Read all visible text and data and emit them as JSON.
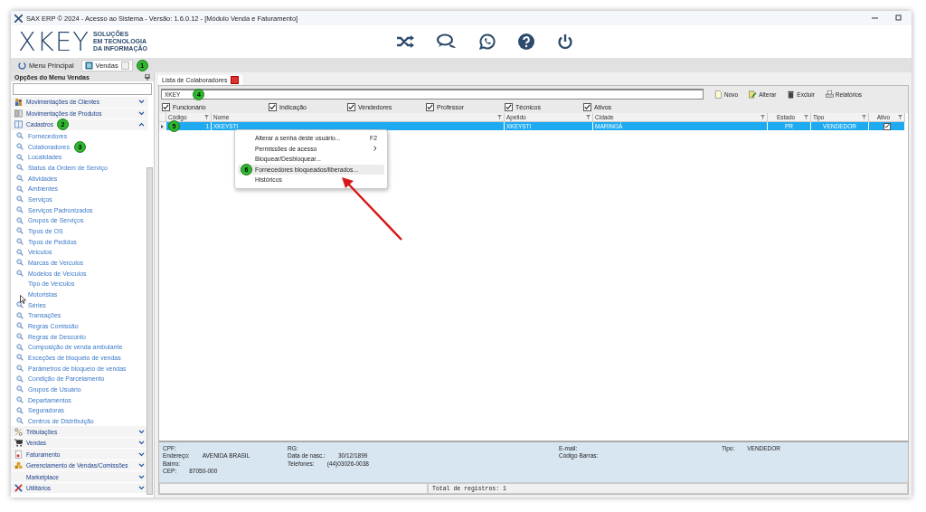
{
  "window": {
    "title": "SAX ERP © 2024 - Acesso ao Sistema - Versão: 1.6.0.12 - [Módulo Venda e Faturamento]"
  },
  "logo": {
    "mark": "XKEY",
    "tagline": [
      "SOLUÇÕES",
      "EM TECNOLOGIA",
      "DA INFORMAÇÃO"
    ]
  },
  "header_icons": [
    {
      "kind": "shuffle"
    },
    {
      "kind": "chat"
    },
    {
      "kind": "whatsapp"
    },
    {
      "kind": "help"
    },
    {
      "kind": "power"
    }
  ],
  "module_tabs": [
    {
      "label": "Menu Principal",
      "kind": "home",
      "selected": false
    },
    {
      "label": "Vendas",
      "kind": "module",
      "selected": true,
      "closable": true,
      "badge": "1"
    }
  ],
  "sidebar": {
    "title": "Opções do Menu Vendas",
    "groups": [
      {
        "label": "Movimentações de Clientes",
        "kind": "people",
        "expanded": false
      },
      {
        "label": "Movimentações de Produtos",
        "kind": "boxes",
        "expanded": false
      },
      {
        "label": "Cadastros",
        "kind": "book",
        "expanded": true,
        "badge": "2",
        "children": [
          {
            "label": "Fornecedores",
            "kind": "search"
          },
          {
            "label": "Colaboradores",
            "kind": "search",
            "badge": "3"
          },
          {
            "label": "Localidades",
            "kind": "search"
          },
          {
            "label": "Status da Ordem de Serviço",
            "kind": "search"
          },
          {
            "label": "Atividades",
            "kind": "search"
          },
          {
            "label": "Ambientes",
            "kind": "search"
          },
          {
            "label": "Serviços",
            "kind": "search"
          },
          {
            "label": "Serviços Padronizados",
            "kind": "search"
          },
          {
            "label": "Grupos de Serviços",
            "kind": "search"
          },
          {
            "label": "Tipos de OS",
            "kind": "search"
          },
          {
            "label": "Tipos de Pedidos",
            "kind": "search"
          },
          {
            "label": "Veículos",
            "kind": "search"
          },
          {
            "label": "Marcas de Veículos",
            "kind": "search"
          },
          {
            "label": "Modelos de Veículos",
            "kind": "search"
          },
          {
            "label": "Tipo de Veículos",
            "kind": "plain"
          },
          {
            "label": "Motoristas",
            "kind": "plain"
          },
          {
            "label": "Séries",
            "kind": "search"
          },
          {
            "label": "Transações",
            "kind": "search"
          },
          {
            "label": "Regras Comissão",
            "kind": "search"
          },
          {
            "label": "Regras de Desconto",
            "kind": "search"
          },
          {
            "label": "Composição de venda ambulante",
            "kind": "search"
          },
          {
            "label": "Exceções de bloqueio de vendas",
            "kind": "search"
          },
          {
            "label": "Parâmetros de bloqueio de vendas",
            "kind": "search"
          },
          {
            "label": "Condição de Parcelamento",
            "kind": "search"
          },
          {
            "label": "Grupos de Usuário",
            "kind": "search"
          },
          {
            "label": "Departamentos",
            "kind": "search"
          },
          {
            "label": "Seguradoras",
            "kind": "search"
          },
          {
            "label": "Centros de Distribuição",
            "kind": "search"
          }
        ]
      },
      {
        "label": "Tributações",
        "kind": "percent",
        "expanded": false
      },
      {
        "label": "Vendas",
        "kind": "cart",
        "expanded": false
      },
      {
        "label": "Faturamento",
        "kind": "invoice",
        "expanded": false
      },
      {
        "label": "Gerenciamento de Vendas/Comissões",
        "kind": "coins",
        "expanded": false
      },
      {
        "label": "Marketplace",
        "kind": "plain",
        "expanded": false
      },
      {
        "label": "Utilitários",
        "kind": "tools",
        "expanded": false
      }
    ]
  },
  "document_tab": {
    "label": "Lista de Colaboradores"
  },
  "search": {
    "value": "XKEY",
    "badge": "4"
  },
  "actions": [
    {
      "label": "Novo",
      "kind": "new"
    },
    {
      "label": "Alterar",
      "kind": "edit"
    },
    {
      "label": "Excluir",
      "kind": "delete"
    },
    {
      "label": "Relatórios",
      "kind": "print"
    }
  ],
  "filters": [
    {
      "label": "Funcionário",
      "checked": true
    },
    {
      "label": "Indicação",
      "checked": true
    },
    {
      "label": "Vendedores",
      "checked": true
    },
    {
      "label": "Professor",
      "checked": true
    },
    {
      "label": "Técnicos",
      "checked": true
    },
    {
      "label": "Ativos",
      "checked": true
    }
  ],
  "table": {
    "columns": [
      {
        "label": "Código"
      },
      {
        "label": "Nome"
      },
      {
        "label": "Apelido"
      },
      {
        "label": "Cidade"
      },
      {
        "label": "Estado"
      },
      {
        "label": "Tipo"
      },
      {
        "label": "Ativo"
      }
    ],
    "rows": [
      {
        "selected": true,
        "badge": "5",
        "codigo": "1",
        "nome": "XKEYSTI",
        "apelido": "XKEYSTI",
        "cidade": "MARINGÁ",
        "estado": "PR",
        "tipo": "VENDEDOR",
        "ativo": true
      }
    ]
  },
  "context_menu": [
    {
      "label": "Alterar a senha deste usuário...",
      "shortcut": "F2",
      "submenu": false,
      "selected": false
    },
    {
      "label": "Permissões de acesso",
      "submenu": true,
      "selected": false
    },
    {
      "label": "Bloquear/Desbloquear...",
      "submenu": false,
      "selected": false
    },
    {
      "label": "Fornecedores bloqueados/liberados...",
      "submenu": false,
      "selected": true,
      "badge": "6"
    },
    {
      "label": "Históricos",
      "submenu": false,
      "selected": false
    }
  ],
  "details": {
    "columns": [
      [
        {
          "label": "CPF:"
        },
        {
          "label": "Endereço:",
          "value": "AVENIDA BRASIL"
        },
        {
          "label": "Bairro:"
        },
        {
          "label": "CEP:",
          "value": "87050-000"
        }
      ],
      [
        {
          "label": "RG:"
        },
        {
          "label": "Data de nasc.:",
          "value": "30/12/1899"
        },
        {
          "label": "Telefones:",
          "value": "(44)03026-0038"
        }
      ],
      [
        {
          "label": "E-mail:"
        },
        {
          "label": "Código Barras:"
        }
      ],
      [
        {
          "label": "Tipo:",
          "value": "VENDEDOR"
        }
      ]
    ]
  },
  "status_bar": {
    "total": "Total de registros: 1"
  }
}
